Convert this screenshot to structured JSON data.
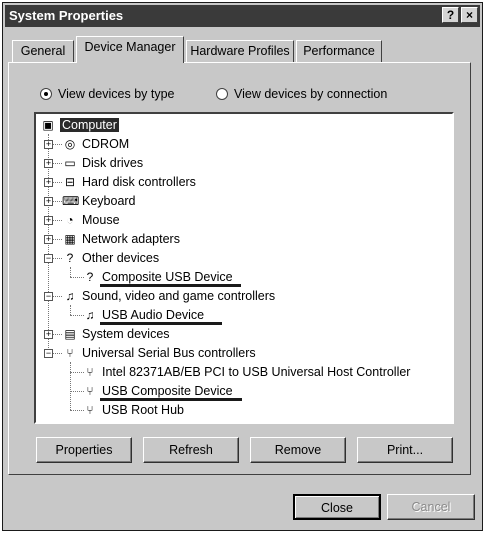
{
  "window": {
    "title": "System Properties",
    "help_button": "?",
    "close_button": "×"
  },
  "tabs": [
    {
      "label": "General",
      "active": false
    },
    {
      "label": "Device Manager",
      "active": true
    },
    {
      "label": "Hardware Profiles",
      "active": false
    },
    {
      "label": "Performance",
      "active": false
    }
  ],
  "view_options": {
    "by_type": {
      "label": "View devices by type",
      "checked": true
    },
    "by_connection": {
      "label": "View devices by connection",
      "checked": false
    }
  },
  "tree": {
    "root": "Computer",
    "items": [
      {
        "label": "CDROM",
        "icon": "cdrom-icon",
        "expanded": false
      },
      {
        "label": "Disk drives",
        "icon": "disk-drive-icon",
        "expanded": false
      },
      {
        "label": "Hard disk controllers",
        "icon": "disk-controller-icon",
        "expanded": false
      },
      {
        "label": "Keyboard",
        "icon": "keyboard-icon",
        "expanded": false
      },
      {
        "label": "Mouse",
        "icon": "mouse-icon",
        "expanded": false
      },
      {
        "label": "Network adapters",
        "icon": "network-adapter-icon",
        "expanded": false
      },
      {
        "label": "Other devices",
        "icon": "unknown-device-icon",
        "expanded": true
      },
      {
        "label": "Composite USB Device",
        "icon": "unknown-device-icon",
        "child": true
      },
      {
        "label": "Sound, video and game controllers",
        "icon": "sound-controller-icon",
        "expanded": true
      },
      {
        "label": "USB Audio Device",
        "icon": "sound-controller-icon",
        "child": true
      },
      {
        "label": "System devices",
        "icon": "system-device-icon",
        "expanded": false
      },
      {
        "label": "Universal Serial Bus controllers",
        "icon": "usb-icon",
        "expanded": true
      },
      {
        "label": "Intel 82371AB/EB PCI to USB Universal Host Controller",
        "icon": "usb-icon",
        "child": true
      },
      {
        "label": "USB Composite Device",
        "icon": "usb-icon",
        "child": true
      },
      {
        "label": "USB Root Hub",
        "icon": "usb-icon",
        "child": true
      }
    ]
  },
  "buttons": {
    "properties": "Properties",
    "refresh": "Refresh",
    "remove": "Remove",
    "print": "Print...",
    "close": "Close",
    "cancel": "Cancel"
  }
}
